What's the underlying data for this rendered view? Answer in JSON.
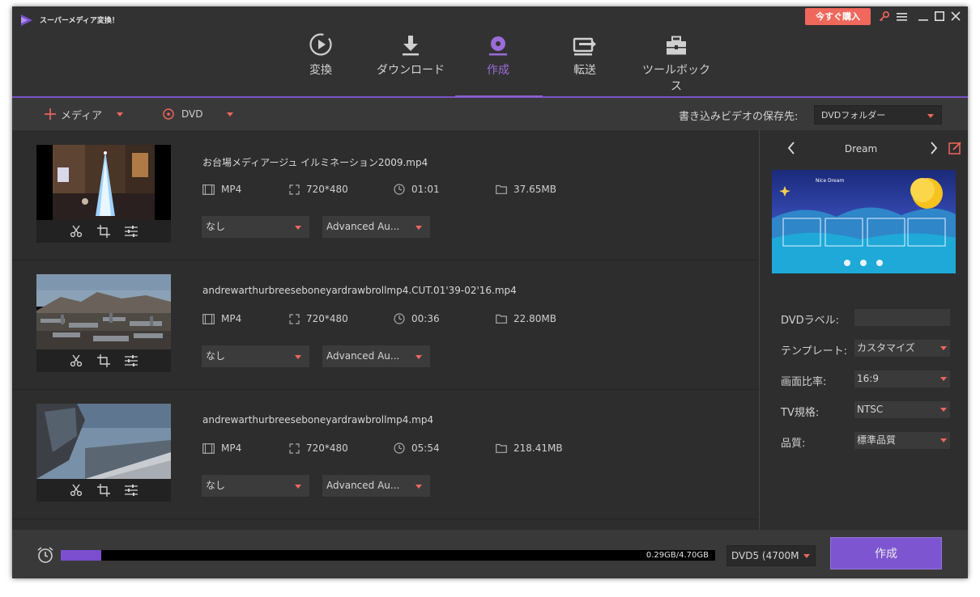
{
  "app": {
    "title": "スーパーメディア変換！",
    "buy_label": "今すぐ購入"
  },
  "nav": [
    {
      "label": "変換",
      "icon": "convert-icon"
    },
    {
      "label": "ダウンロード",
      "icon": "download-icon"
    },
    {
      "label": "作成",
      "icon": "burn-disc-icon",
      "active": true
    },
    {
      "label": "転送",
      "icon": "transfer-icon"
    },
    {
      "label": "ツールボックス",
      "icon": "toolbox-icon"
    }
  ],
  "toolbar": {
    "media_label": "メディア",
    "dvd_label": "DVD",
    "save_to_label": "書き込みビデオの保存先:",
    "save_to_value": "DVDフォルダー"
  },
  "files": [
    {
      "name": "お台場メディアージュ イルミネーション2009.mp4",
      "format": "MP4",
      "resolution": "720*480",
      "duration": "01:01",
      "size": "37.65MB",
      "subtitle": "なし",
      "audio": "Advanced Au..."
    },
    {
      "name": "andrewarthurbreeseboneyardrawbrollmp4.CUT.01'39-02'16.mp4",
      "format": "MP4",
      "resolution": "720*480",
      "duration": "00:36",
      "size": "22.80MB",
      "subtitle": "なし",
      "audio": "Advanced Au..."
    },
    {
      "name": "andrewarthurbreeseboneyardrawbrollmp4.mp4",
      "format": "MP4",
      "resolution": "720*480",
      "duration": "05:54",
      "size": "218.41MB",
      "subtitle": "なし",
      "audio": "Advanced Au..."
    }
  ],
  "panel": {
    "template_name": "Dream",
    "preview_title": "Nice Dream",
    "dvd_label_label": "DVDラベル:",
    "dvd_label_value": "",
    "template_label": "テンプレート:",
    "template_value": "カスタマイズ",
    "aspect_label": "画面比率:",
    "aspect_value": "16:9",
    "tv_label": "TV規格:",
    "tv_value": "NTSC",
    "quality_label": "品質:",
    "quality_value": "標準品質"
  },
  "bottom": {
    "capacity_text": "0.29GB/4.70GB",
    "capacity_fraction": 0.062,
    "disc_type": "DVD5 (4700M",
    "create_label": "作成"
  },
  "colors": {
    "accent": "#7e55d1",
    "buy": "#f0675b",
    "caret": "#f0675b"
  }
}
